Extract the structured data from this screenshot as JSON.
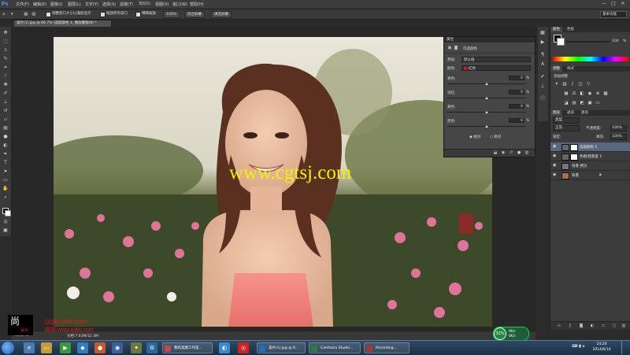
{
  "app": {
    "logo": "Ps",
    "menu": [
      "文件(F)",
      "编辑(E)",
      "图像(I)",
      "图层(L)",
      "文字(Y)",
      "选择(S)",
      "滤镜(T)",
      "3D(D)",
      "视图(V)",
      "窗口(W)",
      "帮助(H)"
    ],
    "window_controls": {
      "minimize": "—",
      "maximize": "□",
      "close": "✕"
    }
  },
  "options_bar": {
    "resize_windows_label": "调整窗口大小以满屏显示",
    "zoom_all_windows_label": "缩放所有窗口",
    "scrubby_zoom_label": "细微缩放",
    "actual_pixels": "100%",
    "fit_screen": "适合屏幕",
    "fill_screen": "填充屏幕",
    "workspace": "基本功能"
  },
  "document": {
    "tab_title": "美片(1).jpg @ 66.7% (选取颜色 1, 图层蒙版/8) *",
    "zoom": "66.67%",
    "doc_size": "文档:7.63M/15.3M"
  },
  "canvas": {
    "watermark": "www.cgtsj.com",
    "logo_char": "尚",
    "logo_sub": "设计",
    "qq_line": "QQ群:####:####",
    "site_line": "网站:www.wjbk.com"
  },
  "properties": {
    "title": "属性",
    "header": "可选颜色",
    "preset_label": "预设:",
    "preset_value": "默认值",
    "colors_label": "颜色:",
    "colors_value": "红色",
    "sliders": [
      {
        "label": "青色:",
        "value": "0",
        "unit": "%"
      },
      {
        "label": "洋红:",
        "value": "0",
        "unit": "%"
      },
      {
        "label": "黄色:",
        "value": "0",
        "unit": "%"
      },
      {
        "label": "黑色:",
        "value": "0",
        "unit": "%"
      }
    ],
    "method_relative": "相对",
    "method_absolute": "绝对"
  },
  "right_dock": {
    "color_tabs": [
      "颜色",
      "色板"
    ],
    "color_value": "100",
    "adjust_tabs": [
      "调整",
      "样式"
    ],
    "adjust_header": "添加调整",
    "layers_tabs": [
      "图层",
      "通道",
      "路径"
    ],
    "kind_label": "类型",
    "blend_mode": "正常",
    "opacity_label": "不透明度:",
    "opacity_value": "100%",
    "lock_label": "锁定:",
    "fill_label": "填充:",
    "fill_value": "100%",
    "layers": [
      {
        "name": "选取颜色 1",
        "active": true,
        "has_mask": true,
        "thumb": "adjust"
      },
      {
        "name": "色相/饱和度 1",
        "active": false,
        "has_mask": true,
        "thumb": "adjust"
      },
      {
        "name": "背景 拷贝",
        "active": false,
        "has_mask": false,
        "thumb": "photo"
      },
      {
        "name": "背景",
        "active": false,
        "has_mask": false,
        "thumb": "photo"
      }
    ]
  },
  "taskbar": {
    "tasks": [
      {
        "label": "我的美图工作室...",
        "color": "#c44"
      },
      {
        "label": "美片(1).jpg @ 6...",
        "color": "#1d6fbf"
      },
      {
        "label": "Camtasia Studio...",
        "color": "#2a7d3c"
      },
      {
        "label": "Recording...",
        "color": "#a33"
      }
    ],
    "clock_time": "14:20",
    "clock_date": "2014/6/14",
    "cpu_percent": "32%",
    "net_up": "0K/s",
    "net_down": "0K/s"
  }
}
